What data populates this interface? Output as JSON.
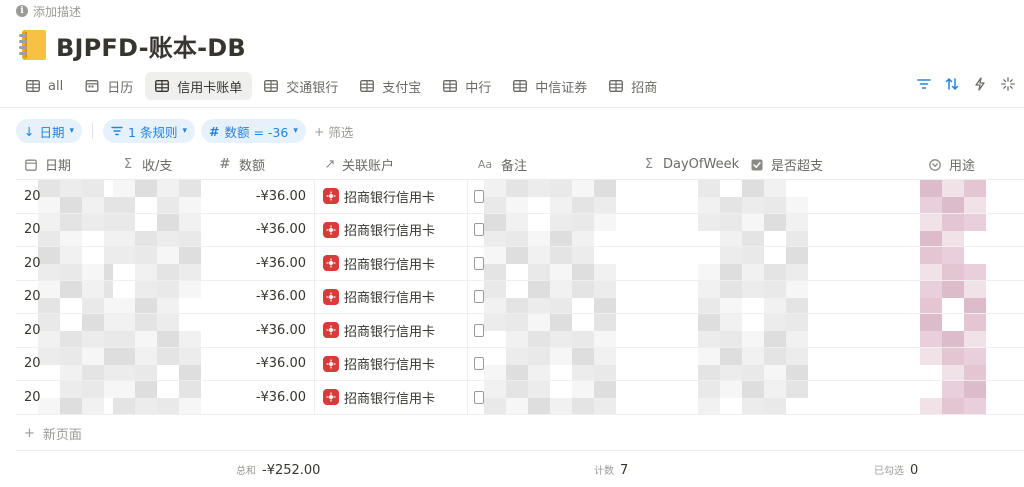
{
  "page": {
    "add_description": "添加描述",
    "title": "BJPFD-账本-DB",
    "title_icon": "notebook-icon"
  },
  "tabs": [
    {
      "label": "all",
      "icon": "table-icon",
      "active": false
    },
    {
      "label": "日历",
      "icon": "calendar-icon",
      "active": false
    },
    {
      "label": "信用卡账单",
      "icon": "table-icon",
      "active": true
    },
    {
      "label": "交通银行",
      "icon": "table-icon",
      "active": false
    },
    {
      "label": "支付宝",
      "icon": "table-icon",
      "active": false
    },
    {
      "label": "中行",
      "icon": "table-icon",
      "active": false
    },
    {
      "label": "中信证券",
      "icon": "table-icon",
      "active": false
    },
    {
      "label": "招商",
      "icon": "table-icon",
      "active": false
    }
  ],
  "toolbar": [
    "filter-icon",
    "sort-icon",
    "lightning-icon",
    "sparkle-icon"
  ],
  "filters": {
    "sort_chip": "日期",
    "rule_chip": "1 条规则",
    "amount_chip": "数额 = -36",
    "add_filter": "筛选"
  },
  "columns": [
    {
      "key": "date",
      "label": "日期",
      "icon": "calendar-icon"
    },
    {
      "key": "io",
      "label": "收/支",
      "icon": "sigma-icon"
    },
    {
      "key": "amount",
      "label": "数额",
      "icon": "hash-icon"
    },
    {
      "key": "account",
      "label": "关联账户",
      "icon": "relation-arrow-icon"
    },
    {
      "key": "note",
      "label": "备注",
      "icon": "text-icon"
    },
    {
      "key": "dow",
      "label": "DayOfWeek",
      "icon": "sigma-icon"
    },
    {
      "key": "overspend",
      "label": "是否超支",
      "icon": "checkbox-icon"
    },
    {
      "key": "use",
      "label": "用途",
      "icon": "select-icon"
    }
  ],
  "rows": [
    {
      "date": "20",
      "amount": "-¥36.00",
      "account": "招商银行信用卡"
    },
    {
      "date": "20",
      "amount": "-¥36.00",
      "account": "招商银行信用卡"
    },
    {
      "date": "20",
      "amount": "-¥36.00",
      "account": "招商银行信用卡"
    },
    {
      "date": "20",
      "amount": "-¥36.00",
      "account": "招商银行信用卡"
    },
    {
      "date": "20",
      "amount": "-¥36.00",
      "account": "招商银行信用卡"
    },
    {
      "date": "20",
      "amount": "-¥36.00",
      "account": "招商银行信用卡"
    },
    {
      "date": "20",
      "amount": "-¥36.00",
      "account": "招商银行信用卡"
    }
  ],
  "new_page": "新页面",
  "footer": {
    "sum_label": "总和",
    "sum_value": "-¥252.00",
    "count_label": "计数",
    "count_value": "7",
    "checked_label": "已勾选",
    "checked_value": "0"
  },
  "colors": {
    "accent": "#2383e2",
    "accent_bg": "#e7f1fb",
    "account_icon": "#d93a3a",
    "use_tag": "#e8c8d6"
  }
}
